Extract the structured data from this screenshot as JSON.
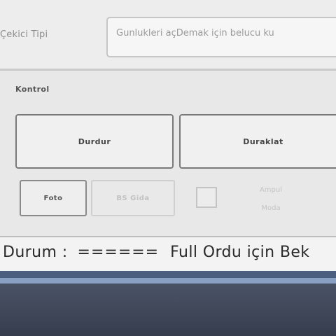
{
  "settings": {
    "type_label": "Çekici Tipi",
    "type_placeholder": "Gunlukleri açDemak için belucu ku"
  },
  "control": {
    "group_title": "Kontrol",
    "stop_label": "Durdur",
    "pause_label": "Duraklat",
    "photo_label": "Foto",
    "bs_label": "BS Gida",
    "lamp_line1": "Ampul",
    "lamp_line2": "Moda"
  },
  "status": {
    "label": "Durum :",
    "separator": "======",
    "message": "Full Ordu için Bek"
  }
}
